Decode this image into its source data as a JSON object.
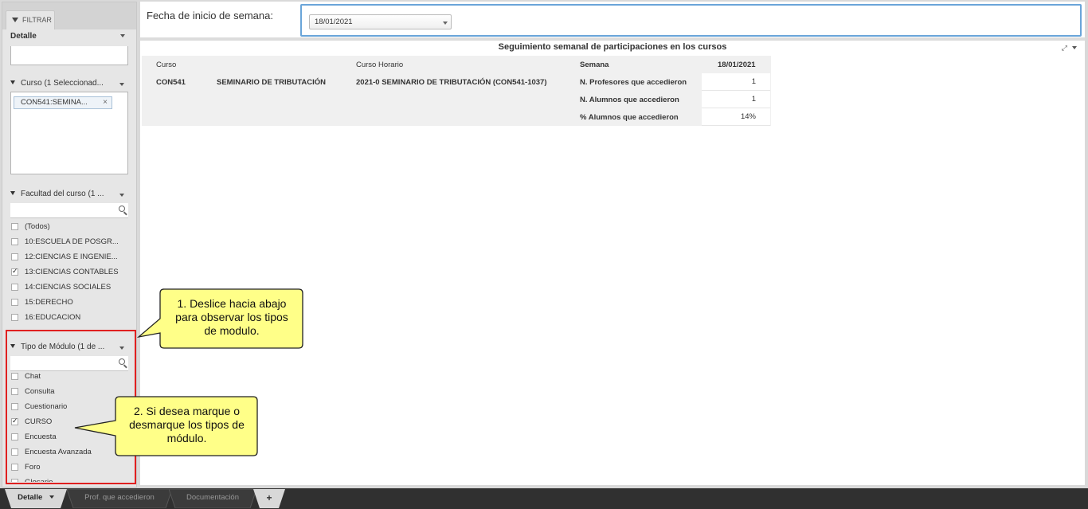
{
  "filters": {
    "tab_label": "FILTRAR",
    "detail_label": "Detalle",
    "course": {
      "title": "Curso (1 Seleccionad...",
      "chip": "CON541:SEMINA...",
      "chip_remove": "×"
    },
    "faculty": {
      "title": "Facultad del curso (1 ...",
      "items": [
        {
          "label": "(Todos)",
          "checked": false
        },
        {
          "label": "10:ESCUELA DE POSGR...",
          "checked": false
        },
        {
          "label": "12:CIENCIAS E INGENIE...",
          "checked": false
        },
        {
          "label": "13:CIENCIAS CONTABLES",
          "checked": true
        },
        {
          "label": "14:CIENCIAS SOCIALES",
          "checked": false
        },
        {
          "label": "15:DERECHO",
          "checked": false
        },
        {
          "label": "16:EDUCACION",
          "checked": false
        }
      ]
    },
    "module_type": {
      "title": "Tipo de Módulo (1 de ...",
      "items": [
        {
          "label": "Chat",
          "checked": false
        },
        {
          "label": "Consulta",
          "checked": false
        },
        {
          "label": "Cuestionario",
          "checked": false
        },
        {
          "label": "CURSO",
          "checked": true
        },
        {
          "label": "Encuesta",
          "checked": false
        },
        {
          "label": "Encuesta Avanzada",
          "checked": false
        },
        {
          "label": "Foro",
          "checked": false
        },
        {
          "label": "Glosario",
          "checked": false
        }
      ]
    }
  },
  "parameter": {
    "label": "Fecha de inicio de semana:",
    "value": "18/01/2021"
  },
  "viz": {
    "title": "Seguimiento semanal de participaciones en los cursos",
    "headers": {
      "curso": "Curso",
      "curso_horario": "Curso Horario",
      "semana": "Semana",
      "date": "18/01/2021"
    },
    "row": {
      "code": "CON541",
      "name": "SEMINARIO DE TRIBUTACIÓN",
      "horario": "2021-0 SEMINARIO DE TRIBUTACIÓN (CON541-1037)"
    },
    "measures": [
      {
        "label": "N. Profesores que accedieron",
        "value": "1"
      },
      {
        "label": "N. Alumnos que accedieron",
        "value": "1"
      },
      {
        "label": "% Alumnos que accedieron",
        "value": "14%"
      }
    ]
  },
  "callouts": {
    "one": [
      "1. Deslice hacia abajo",
      "para observar los tipos",
      "de modulo."
    ],
    "two": [
      "2. Si desea marque o",
      "desmarque los tipos de",
      "módulo."
    ]
  },
  "tabs": [
    {
      "label": "Detalle",
      "active": true
    },
    {
      "label": "Prof. que accedieron",
      "active": false
    },
    {
      "label": "Documentación",
      "active": false
    },
    {
      "label": "+",
      "active": false
    }
  ],
  "colors": {
    "accent": "#6aa5d9",
    "callout_fill": "#ffff88",
    "highlight": "#e02020"
  }
}
